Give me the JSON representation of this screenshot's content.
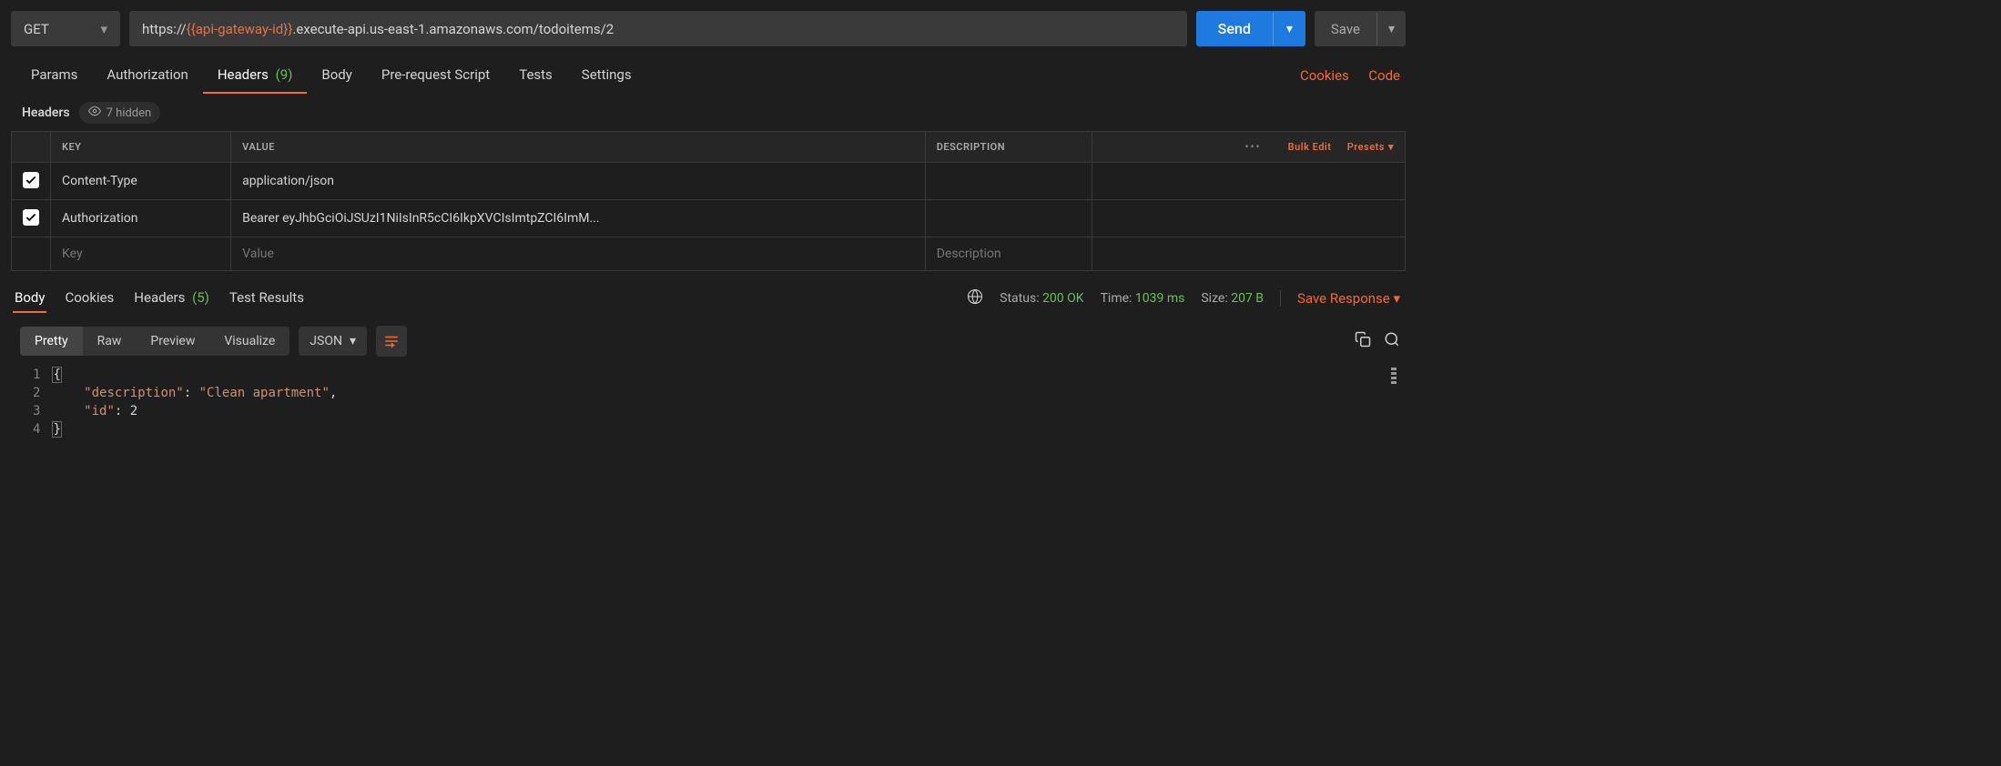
{
  "request": {
    "method": "GET",
    "url_prefix": "https://",
    "url_var": "{{api-gateway-id}}",
    "url_suffix": ".execute-api.us-east-1.amazonaws.com/todoitems/2",
    "send_label": "Send",
    "save_label": "Save"
  },
  "req_tabs": {
    "params": "Params",
    "authorization": "Authorization",
    "headers": "Headers",
    "headers_count": "(9)",
    "body": "Body",
    "prerequest": "Pre-request Script",
    "tests": "Tests",
    "settings": "Settings",
    "cookies_link": "Cookies",
    "code_link": "Code",
    "active": "headers"
  },
  "headers_section": {
    "title": "Headers",
    "hidden_label": "7 hidden",
    "columns": {
      "key": "KEY",
      "value": "VALUE",
      "description": "DESCRIPTION"
    },
    "bulk_edit": "Bulk Edit",
    "presets": "Presets",
    "rows": [
      {
        "checked": true,
        "key": "Content-Type",
        "value": "application/json",
        "description": ""
      },
      {
        "checked": true,
        "key": "Authorization",
        "value": "Bearer eyJhbGciOiJSUzI1NiIsInR5cCI6IkpXVCIsImtpZCI6ImM...",
        "description": ""
      }
    ],
    "placeholders": {
      "key": "Key",
      "value": "Value",
      "description": "Description"
    }
  },
  "response_tabs": {
    "body": "Body",
    "cookies": "Cookies",
    "headers": "Headers",
    "headers_count": "(5)",
    "testresults": "Test Results",
    "active": "body",
    "status_label": "Status:",
    "status_value": "200 OK",
    "time_label": "Time:",
    "time_value": "1039 ms",
    "size_label": "Size:",
    "size_value": "207 B",
    "save_response": "Save Response"
  },
  "body_toolbar": {
    "pretty": "Pretty",
    "raw": "Raw",
    "preview": "Preview",
    "visualize": "Visualize",
    "lang": "JSON",
    "active": "pretty"
  },
  "response_body": {
    "lines": [
      "1",
      "2",
      "3",
      "4"
    ],
    "json": {
      "description": "Clean apartment",
      "id": 2
    }
  }
}
